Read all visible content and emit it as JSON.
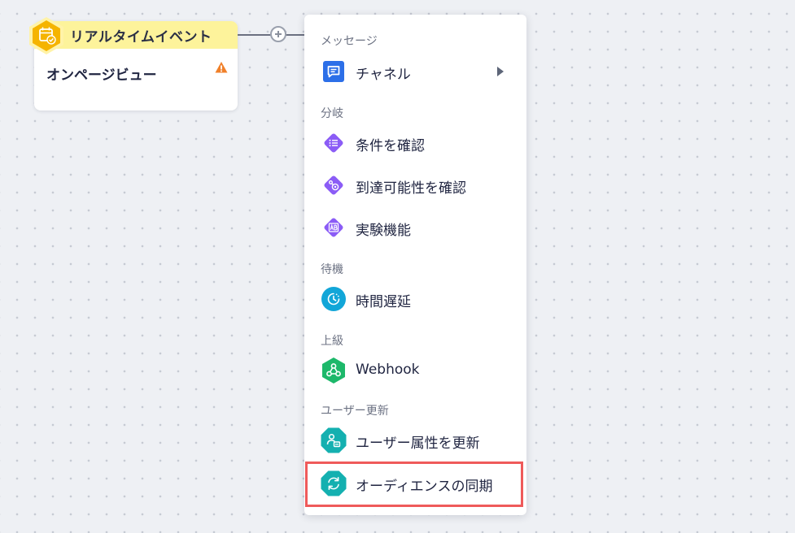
{
  "trigger": {
    "header_label": "リアルタイムイベント",
    "subtitle": "オンページビュー",
    "header_color": "#fdf39b",
    "icon": "calendar-check-icon",
    "icon_color": "#f5b400",
    "warning_icon": "warning-icon",
    "warning_color": "#f0802a"
  },
  "menu": {
    "sections": [
      {
        "header": "メッセージ",
        "items": [
          {
            "label": "チャネル",
            "icon": "chat-icon",
            "icon_color": "#2c6fe8",
            "has_submenu": true
          }
        ]
      },
      {
        "header": "分岐",
        "items": [
          {
            "label": "条件を確認",
            "icon": "list-diamond-icon",
            "icon_color": "#8b5cf6"
          },
          {
            "label": "到達可能性を確認",
            "icon": "reachability-diamond-icon",
            "icon_color": "#8b5cf6"
          },
          {
            "label": "実験機能",
            "icon": "ab-test-diamond-icon",
            "icon_color": "#8b5cf6"
          }
        ]
      },
      {
        "header": "待機",
        "items": [
          {
            "label": "時間遅延",
            "icon": "clock-icon",
            "icon_color": "#12a6d8"
          }
        ]
      },
      {
        "header": "上級",
        "items": [
          {
            "label": "Webhook",
            "icon": "webhook-icon",
            "icon_color": "#1db86a"
          }
        ]
      },
      {
        "header": "ユーザー更新",
        "items": [
          {
            "label": "ユーザー属性を更新",
            "icon": "user-attribute-icon",
            "icon_color": "#14b0b0"
          },
          {
            "label": "オーディエンスの同期",
            "icon": "sync-icon",
            "icon_color": "#14b0b0",
            "highlighted": true
          }
        ]
      }
    ]
  },
  "colors": {
    "highlight_border": "#ef5a5a",
    "canvas_bg": "#eef0f4"
  }
}
